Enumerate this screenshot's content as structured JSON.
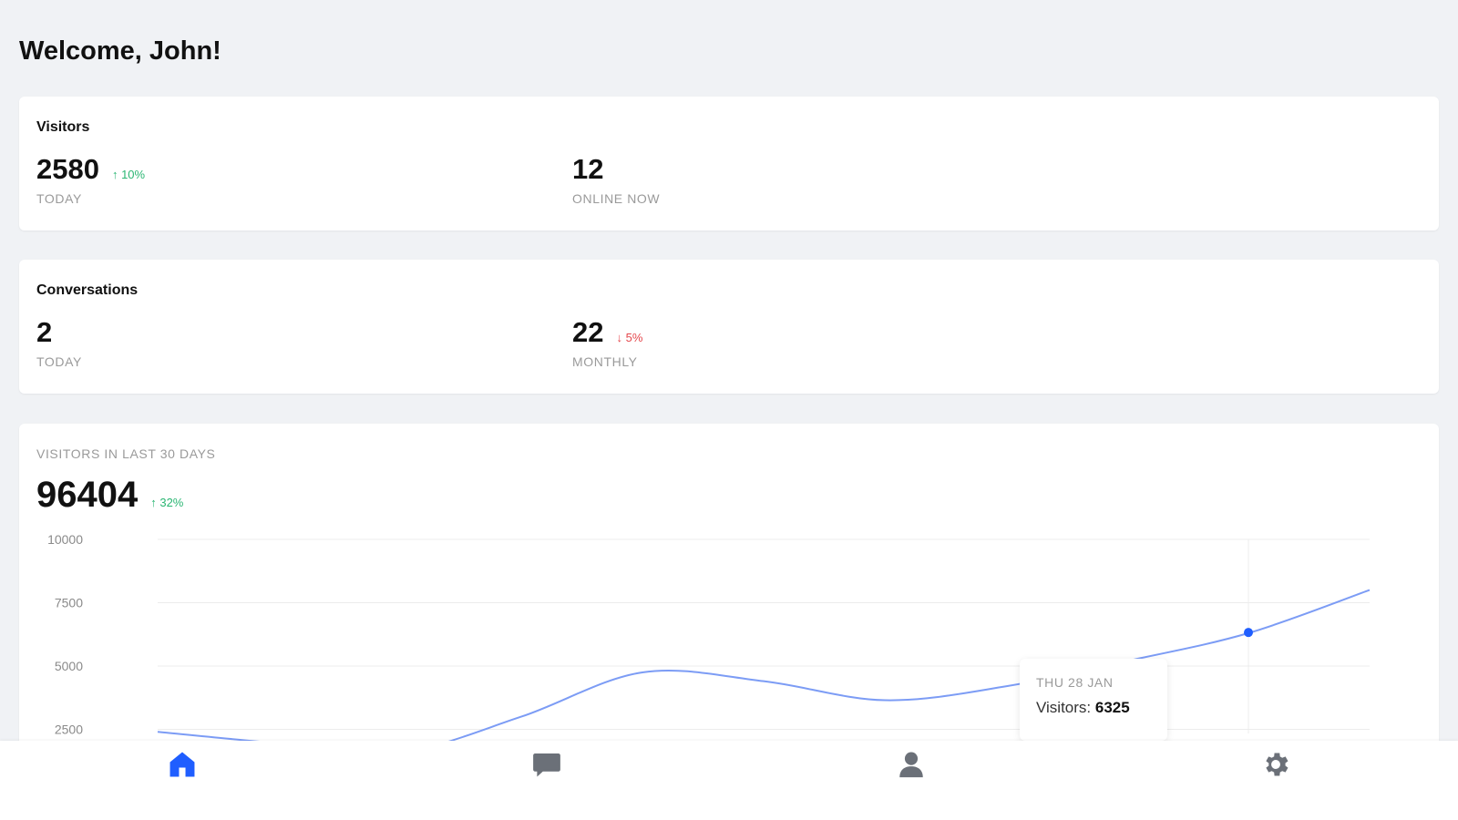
{
  "header": {
    "greeting": "Welcome, John!"
  },
  "visitors_card": {
    "title": "Visitors",
    "stats": [
      {
        "value": "2580",
        "change": "↑ 10%",
        "change_direction": "up",
        "label": "TODAY"
      },
      {
        "value": "12",
        "change": "",
        "change_direction": "",
        "label": "ONLINE NOW"
      }
    ]
  },
  "conversations_card": {
    "title": "Conversations",
    "stats": [
      {
        "value": "2",
        "change": "",
        "change_direction": "",
        "label": "TODAY"
      },
      {
        "value": "22",
        "change": "↓ 5%",
        "change_direction": "down",
        "label": "MONTHLY"
      }
    ]
  },
  "chart_card": {
    "title": "VISITORS IN LAST 30 DAYS",
    "total": "96404",
    "change": "↑ 32%",
    "tooltip": {
      "date": "THU 28 JAN",
      "label": "Visitors:",
      "value": "6325"
    }
  },
  "chart_data": {
    "type": "line",
    "title": "",
    "xlabel": "",
    "ylabel": "",
    "ylim": [
      0,
      10000
    ],
    "yticks": [
      2500,
      5000,
      7500,
      10000
    ],
    "grid": true,
    "legend": "none",
    "series": [
      {
        "name": "",
        "x": [
          0,
          3,
          6,
          9,
          12,
          15,
          18,
          21,
          24,
          27,
          30
        ],
        "y": [
          2400,
          1950,
          1600,
          3000,
          4750,
          4400,
          3650,
          4200,
          5200,
          6300,
          8000
        ],
        "color": "#7c9cf5"
      }
    ],
    "highlight": {
      "x": 27,
      "y": 6325
    }
  },
  "bottom_nav": [
    {
      "name": "home",
      "icon": "home-icon",
      "active": true
    },
    {
      "name": "messages",
      "icon": "chat-icon",
      "active": false
    },
    {
      "name": "profile",
      "icon": "user-icon",
      "active": false
    },
    {
      "name": "settings",
      "icon": "gear-icon",
      "active": false
    }
  ],
  "colors": {
    "accent": "#1f5eff",
    "positive": "#2bb673",
    "negative": "#e5484d",
    "icon_inactive": "#6b7078",
    "line": "#7c9cf5"
  }
}
